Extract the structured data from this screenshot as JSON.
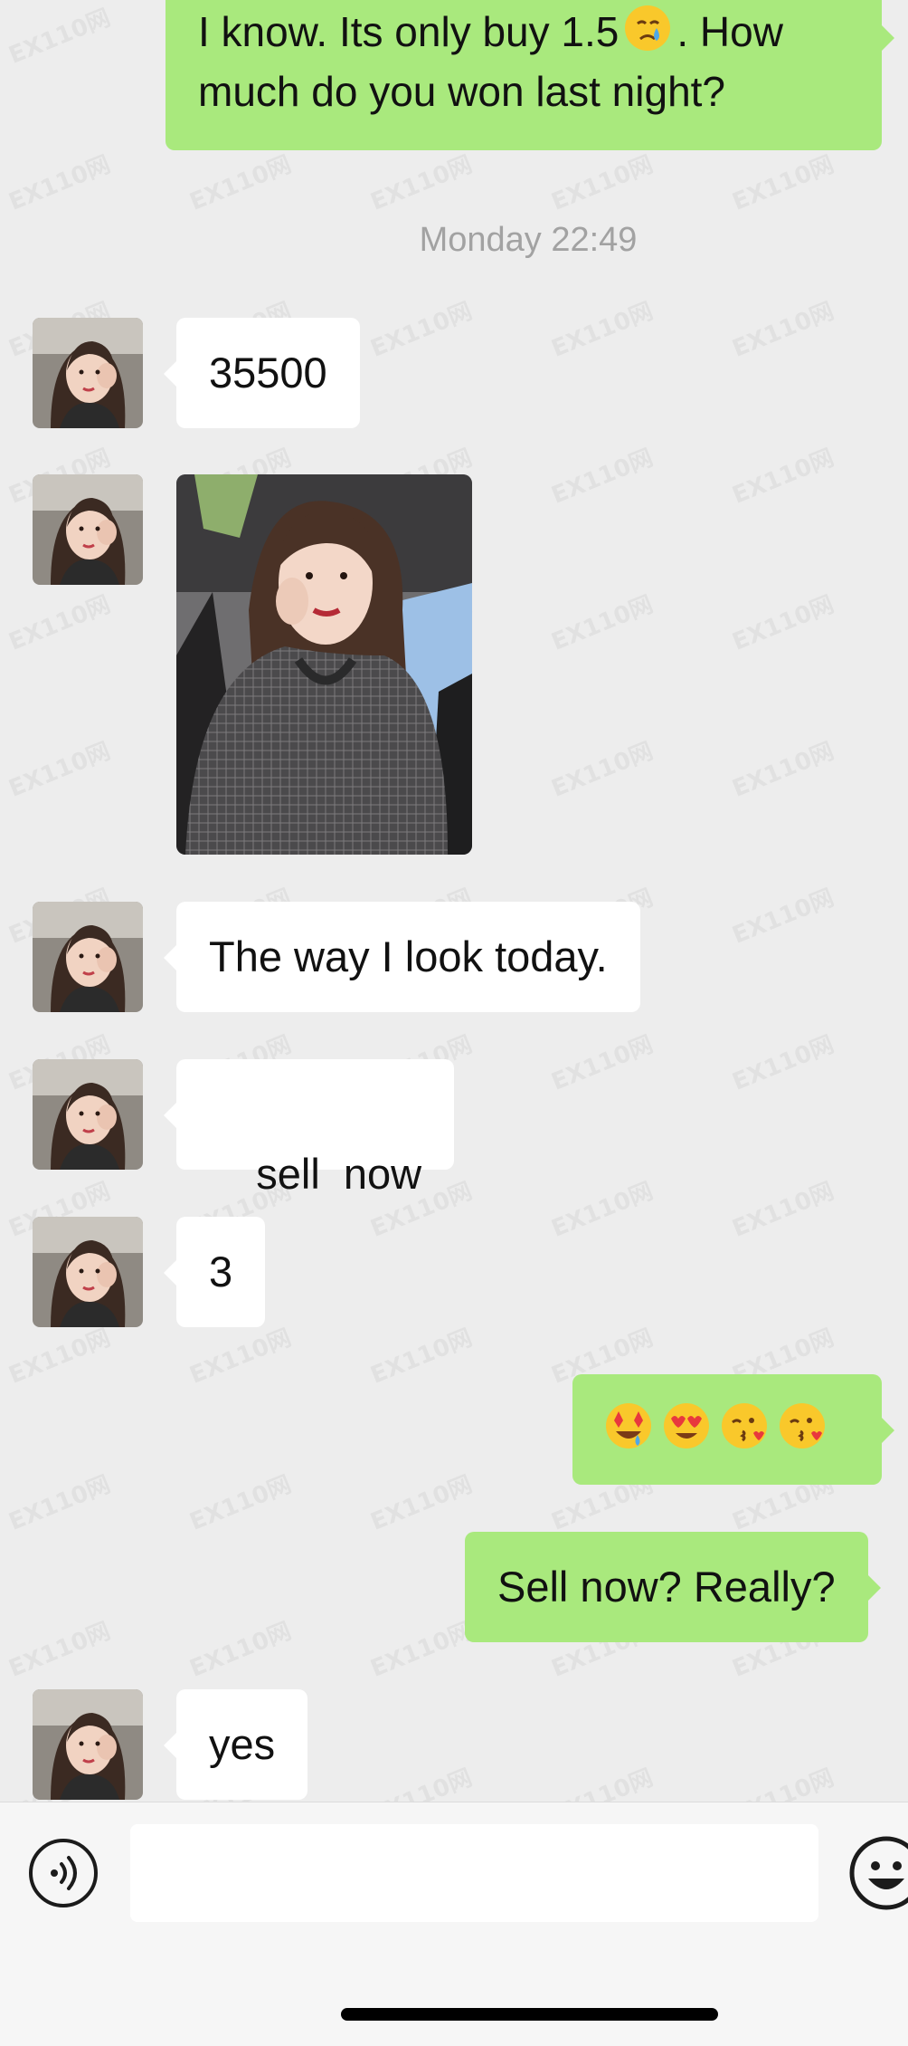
{
  "chat": {
    "messages": [
      {
        "id": "m1",
        "side": "out",
        "text_line1": "I know. Its only buy 1.5",
        "text_line1_b": ". How",
        "text_line2": "much do you won last night?",
        "emoji": "crying-face"
      },
      {
        "id": "ts1",
        "type": "timestamp",
        "text": "Monday 22:49"
      },
      {
        "id": "m2",
        "side": "in",
        "text": "35500"
      },
      {
        "id": "m3",
        "side": "in",
        "type": "image",
        "alt": "selfie-photo"
      },
      {
        "id": "m4",
        "side": "in",
        "text": "The way I look today."
      },
      {
        "id": "m5",
        "side": "in",
        "text": "sell  now"
      },
      {
        "id": "m6",
        "side": "in",
        "text": "3"
      },
      {
        "id": "m7",
        "side": "out",
        "type": "emoji",
        "emojis": [
          "star-struck-face",
          "heart-eyes-face",
          "kissing-heart-face",
          "kissing-heart-face"
        ]
      },
      {
        "id": "m8",
        "side": "out",
        "text": "Sell now? Really?"
      },
      {
        "id": "m9",
        "side": "in",
        "text": "yes"
      }
    ]
  },
  "input_bar": {
    "voice_icon": "voice-icon",
    "emoji_icon": "smiley-icon",
    "input_value": "",
    "input_placeholder": ""
  },
  "watermark": {
    "text": "EX110网"
  },
  "colors": {
    "background": "#ededed",
    "outgoing_bubble": "#a9e97d",
    "incoming_bubble": "#ffffff",
    "timestamp": "#a2a2a2",
    "input_bar": "#f6f6f6"
  }
}
